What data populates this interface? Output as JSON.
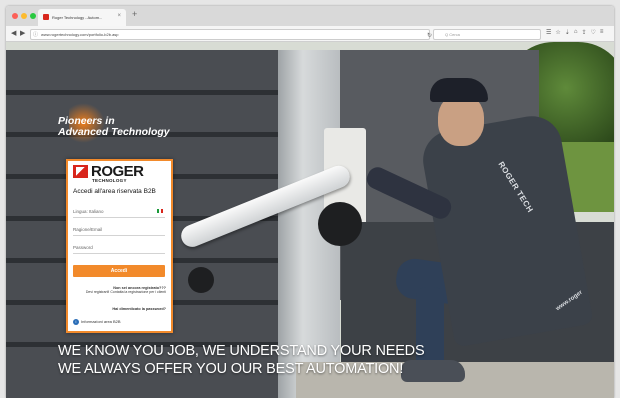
{
  "browser": {
    "tab_title": "Roger Technology - Autom...",
    "tab_close": "×",
    "new_tab": "+",
    "url": "www.rogertechnology.com/portfolio-b2b.asp",
    "search_placeholder": "Q Cerca"
  },
  "page": {
    "tagline_line1": "Pioneers in",
    "tagline_line2": "Advanced Technology",
    "slogan_line1": "WE KNOW YOU JOB, WE UNDERSTAND YOUR NEEDS",
    "slogan_line2": "WE ALWAYS OFFER YOU OUR BEST AUTOMATION!",
    "vest_brand": "ROGER TECH",
    "vest_www": "www.roger"
  },
  "login": {
    "logo_text": "ROGER",
    "logo_sub": "TECHNOLOGY",
    "title": "Accedi all'area riservata B2B",
    "language_value": "Lingua: Italiano",
    "username_placeholder": "Ragione/Email",
    "password_placeholder": "Password",
    "submit_label": "Accedi",
    "register_heading": "Non sei ancora registrato???",
    "register_text": "Devi registrarti! Contatta la registrazione per i clienti",
    "recover_label": "Hai dimenticato la password?",
    "info_label": "Informazioni area B2B"
  },
  "colors": {
    "accent": "#f28a2b",
    "brand_red": "#d8261c",
    "info_blue": "#2a6db7"
  }
}
